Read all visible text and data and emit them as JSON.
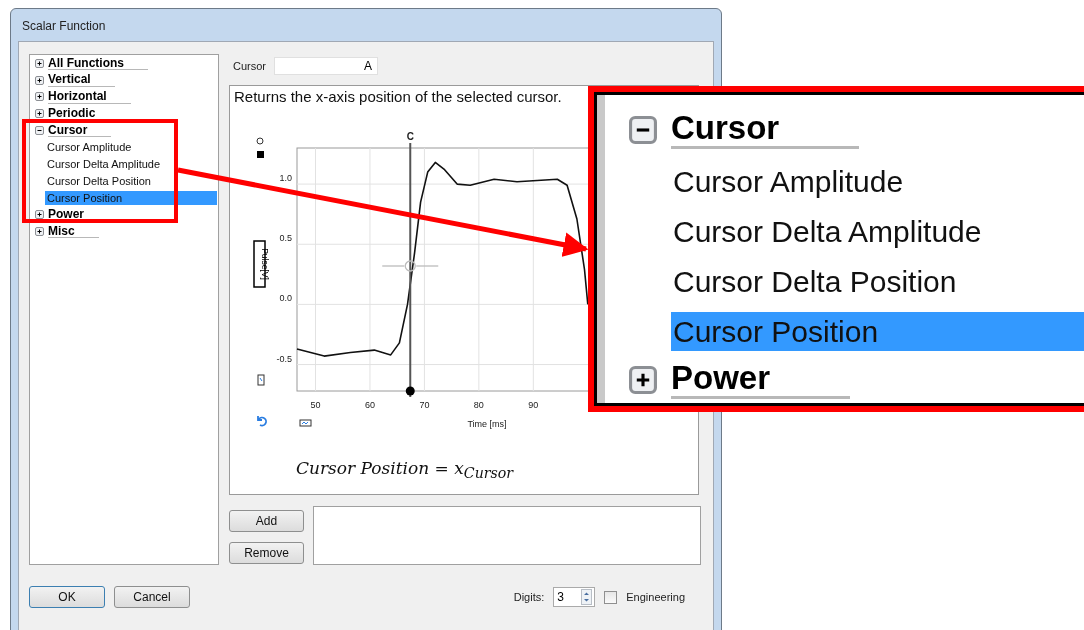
{
  "window": {
    "title": "Scalar Function"
  },
  "tree": {
    "items": [
      {
        "label": "All Functions",
        "expanded": false,
        "selected": false
      },
      {
        "label": "Vertical",
        "expanded": false,
        "selected": false
      },
      {
        "label": "Horizontal",
        "expanded": false,
        "selected": false
      },
      {
        "label": "Periodic",
        "expanded": false,
        "selected": false
      },
      {
        "label": "Cursor",
        "expanded": true,
        "selected": false,
        "children": [
          {
            "label": "Cursor Amplitude",
            "selected": false
          },
          {
            "label": "Cursor Delta Amplitude",
            "selected": false
          },
          {
            "label": "Cursor Delta Position",
            "selected": false
          },
          {
            "label": "Cursor Position",
            "selected": true
          }
        ]
      },
      {
        "label": "Power",
        "expanded": false,
        "selected": false
      },
      {
        "label": "Misc",
        "expanded": false,
        "selected": false
      }
    ]
  },
  "cursor_field": {
    "label": "Cursor",
    "value": "A"
  },
  "description": "Returns the x-axis position of the selected cursor.",
  "chart": {
    "chart_data": {
      "type": "line",
      "grid": true,
      "xlabel": "Time [ms]",
      "ylabel": "Pulse[V]",
      "ref_lines": [
        {
          "axis": "x",
          "value": 67.4,
          "label": "C"
        }
      ],
      "x": [
        46.6,
        51.6,
        56.4,
        60.8,
        63.8,
        65.4,
        66.9,
        68.2,
        69.3,
        70.6,
        72,
        73.7,
        76,
        78.4,
        82.8,
        87,
        90.7,
        94.4,
        96.2,
        98,
        99.4,
        100
      ],
      "series": [
        {
          "color": "#111111",
          "values": [
            -0.37,
            -0.43,
            -0.4,
            -0.38,
            -0.42,
            -0.32,
            0,
            0.43,
            0.85,
            1.1,
            1.18,
            1.12,
            1,
            0.99,
            1.04,
            1.02,
            1.03,
            1.04,
            0.99,
            0.71,
            0.29,
            0
          ]
        }
      ],
      "xlim": [
        46.6,
        105
      ],
      "ylim": [
        -0.72,
        1.3
      ],
      "xticks": [
        50,
        60,
        70,
        80,
        90
      ],
      "yticks": [
        {
          "value": 1,
          "label": "1.0"
        },
        {
          "value": 0.5,
          "label": "0.5"
        },
        {
          "value": 0,
          "label": "0.0"
        },
        {
          "value": -0.5,
          "label": "-0.5"
        }
      ]
    }
  },
  "formula": "Cursor Position = x$_{Cursor}$",
  "buttons": [
    {
      "label": "Add"
    },
    {
      "label": "Remove"
    }
  ],
  "footer": {
    "ok": "OK",
    "cancel": "Cancel",
    "digits_label": "Digits:",
    "digits_value": "3",
    "engineering": {
      "label": "Engineering",
      "checked": false
    }
  },
  "callout": {
    "items": [
      {
        "kind": "group",
        "label": "Cursor",
        "expanded": true,
        "selected": false
      },
      {
        "kind": "item",
        "label": "Cursor Amplitude",
        "selected": false
      },
      {
        "kind": "item",
        "label": "Cursor Delta Amplitude",
        "selected": false
      },
      {
        "kind": "item",
        "label": "Cursor Delta Position",
        "selected": false
      },
      {
        "kind": "item",
        "label": "Cursor Position",
        "selected": true
      },
      {
        "kind": "group",
        "label": "Power",
        "expanded": false,
        "selected": false
      }
    ]
  }
}
